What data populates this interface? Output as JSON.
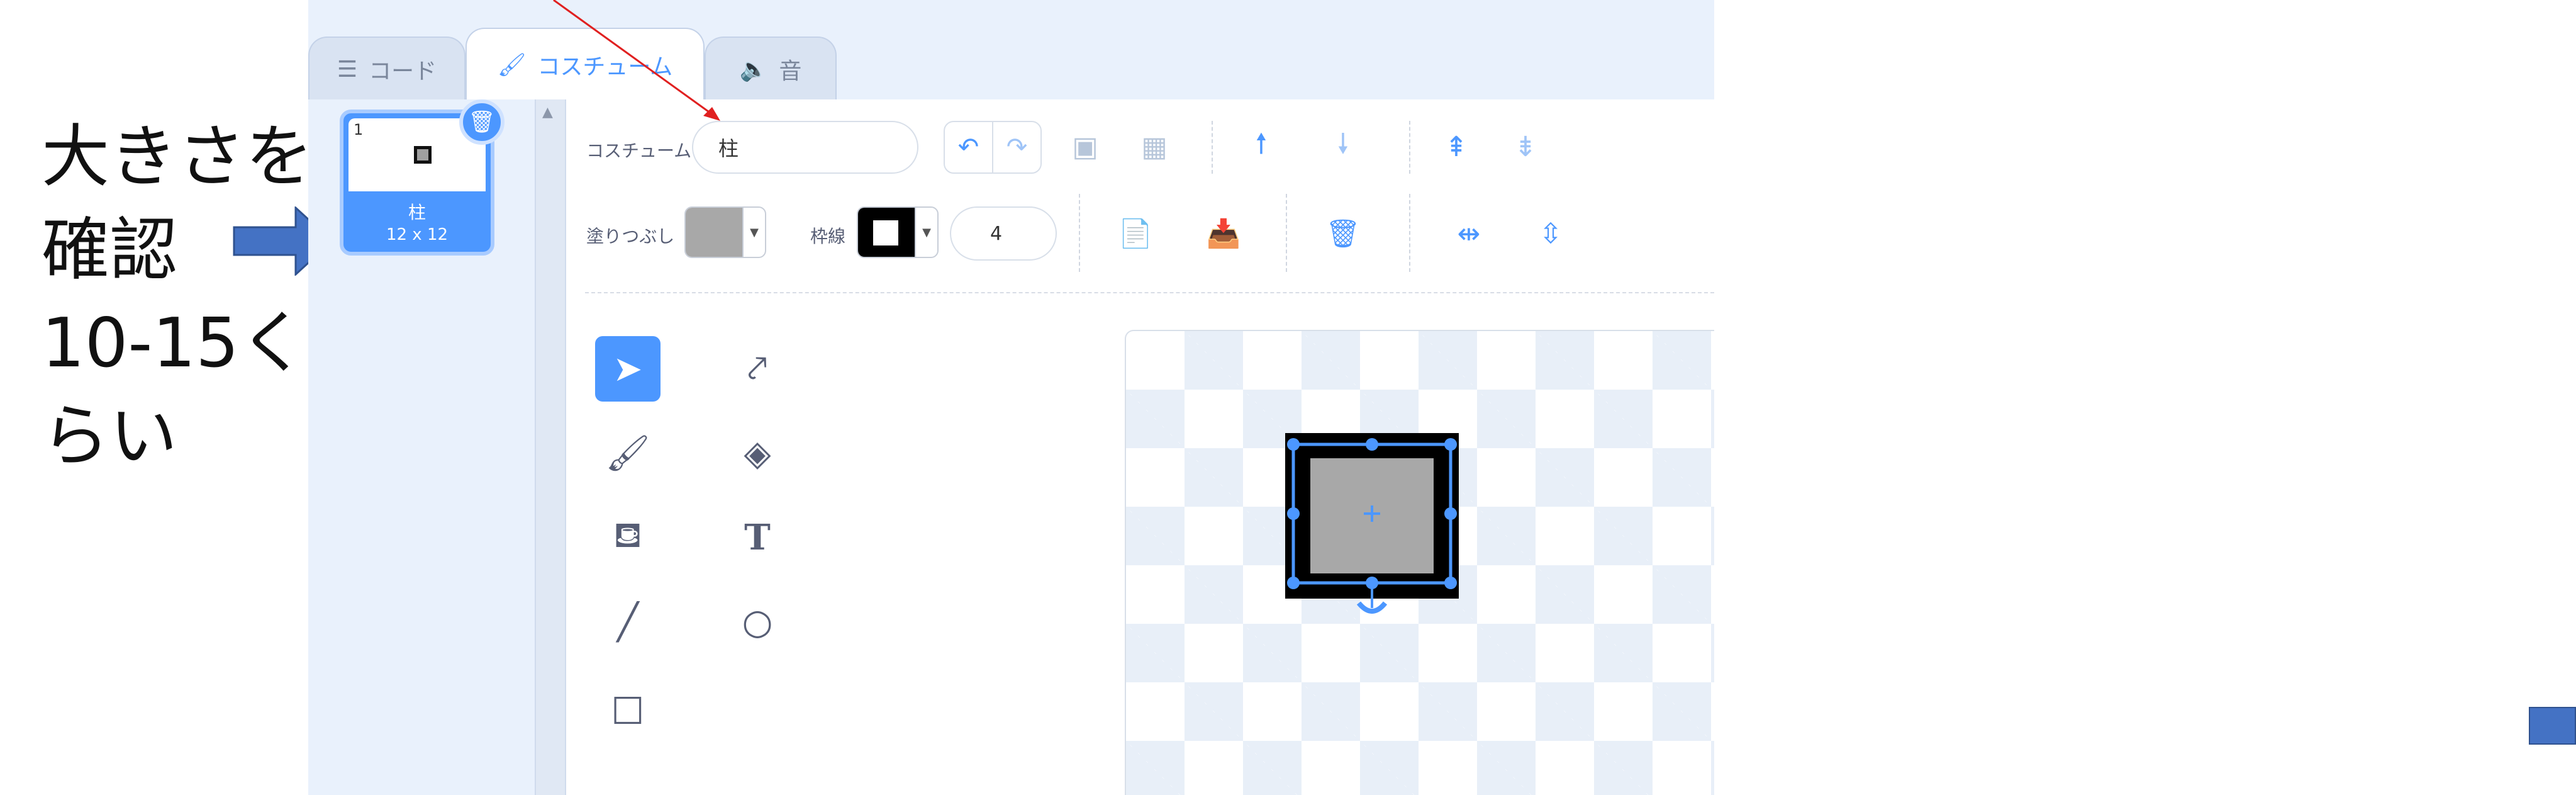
{
  "annotation": {
    "lines": [
      "大きさを",
      "確認",
      "10-15く",
      "らい"
    ],
    "arrow_color": "#4472c4",
    "pointer_line_color": "#e02020"
  },
  "tabs": [
    {
      "label": "コード",
      "icon": "code-blocks-icon",
      "active": false
    },
    {
      "label": "コスチューム",
      "icon": "paintbrush-icon",
      "active": true
    },
    {
      "label": "音",
      "icon": "speaker-icon",
      "active": false
    }
  ],
  "costume_list": {
    "items": [
      {
        "number": "1",
        "name": "柱",
        "size": "12 x 12",
        "selected": true
      }
    ]
  },
  "toolbar": {
    "costume_label": "コスチューム",
    "costume_name": "柱",
    "fill_label": "塗りつぶし",
    "fill_color": "#a8a8a8",
    "outline_label": "枠線",
    "outline_color": "#000000",
    "outline_width": "4",
    "undo_icon": "undo-icon",
    "redo_icon": "redo-icon",
    "group_icon": "group-icon",
    "ungroup_icon": "ungroup-icon",
    "forward_icon": "forward-icon",
    "backward_icon": "backward-icon",
    "front_icon": "front-icon",
    "back_icon": "back-icon",
    "copy_icon": "copy-icon",
    "paste_icon": "paste-icon",
    "delete_icon": "trash-icon",
    "flip_h_icon": "flip-horizontal-icon",
    "flip_v_icon": "flip-vertical-icon"
  },
  "tools": [
    {
      "name": "select-tool",
      "icon": "arrow-cursor-icon",
      "active": true
    },
    {
      "name": "reshape-tool",
      "icon": "reshape-icon",
      "active": false
    },
    {
      "name": "brush-tool",
      "icon": "brush-icon",
      "active": false
    },
    {
      "name": "eraser-tool",
      "icon": "eraser-icon",
      "active": false
    },
    {
      "name": "fill-tool",
      "icon": "paint-bucket-icon",
      "active": false
    },
    {
      "name": "text-tool",
      "icon": "text-icon",
      "active": false
    },
    {
      "name": "line-tool",
      "icon": "line-icon",
      "active": false
    },
    {
      "name": "circle-tool",
      "icon": "circle-icon",
      "active": false
    },
    {
      "name": "rectangle-tool",
      "icon": "rectangle-icon",
      "active": false
    }
  ],
  "colors": {
    "accent": "#4c97ff",
    "frame_bg": "#e9f1fc",
    "text_gray": "#575e75"
  }
}
